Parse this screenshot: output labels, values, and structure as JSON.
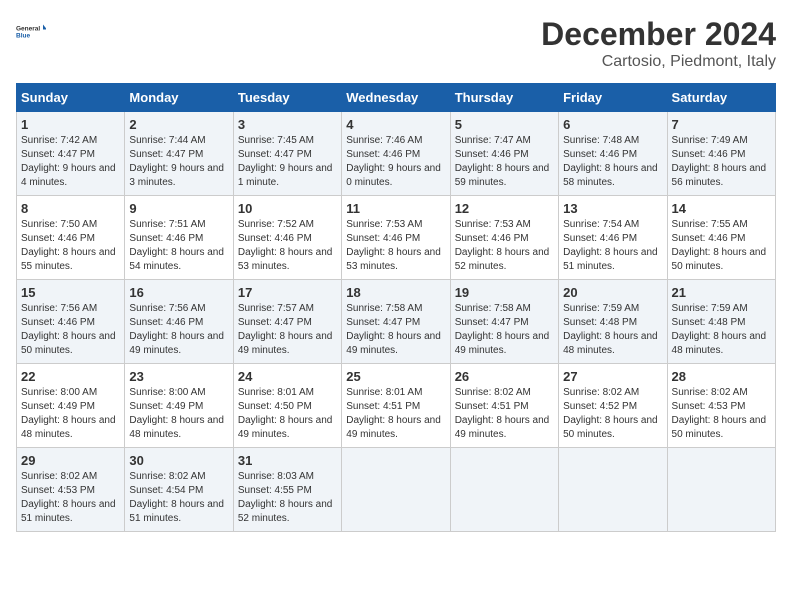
{
  "header": {
    "logo_general": "General",
    "logo_blue": "Blue",
    "month_year": "December 2024",
    "location": "Cartosio, Piedmont, Italy"
  },
  "weekdays": [
    "Sunday",
    "Monday",
    "Tuesday",
    "Wednesday",
    "Thursday",
    "Friday",
    "Saturday"
  ],
  "weeks": [
    [
      {
        "day": "1",
        "sunrise": "7:42 AM",
        "sunset": "4:47 PM",
        "daylight": "9 hours and 4 minutes."
      },
      {
        "day": "2",
        "sunrise": "7:44 AM",
        "sunset": "4:47 PM",
        "daylight": "9 hours and 3 minutes."
      },
      {
        "day": "3",
        "sunrise": "7:45 AM",
        "sunset": "4:47 PM",
        "daylight": "9 hours and 1 minute."
      },
      {
        "day": "4",
        "sunrise": "7:46 AM",
        "sunset": "4:46 PM",
        "daylight": "9 hours and 0 minutes."
      },
      {
        "day": "5",
        "sunrise": "7:47 AM",
        "sunset": "4:46 PM",
        "daylight": "8 hours and 59 minutes."
      },
      {
        "day": "6",
        "sunrise": "7:48 AM",
        "sunset": "4:46 PM",
        "daylight": "8 hours and 58 minutes."
      },
      {
        "day": "7",
        "sunrise": "7:49 AM",
        "sunset": "4:46 PM",
        "daylight": "8 hours and 56 minutes."
      }
    ],
    [
      {
        "day": "8",
        "sunrise": "7:50 AM",
        "sunset": "4:46 PM",
        "daylight": "8 hours and 55 minutes."
      },
      {
        "day": "9",
        "sunrise": "7:51 AM",
        "sunset": "4:46 PM",
        "daylight": "8 hours and 54 minutes."
      },
      {
        "day": "10",
        "sunrise": "7:52 AM",
        "sunset": "4:46 PM",
        "daylight": "8 hours and 53 minutes."
      },
      {
        "day": "11",
        "sunrise": "7:53 AM",
        "sunset": "4:46 PM",
        "daylight": "8 hours and 53 minutes."
      },
      {
        "day": "12",
        "sunrise": "7:53 AM",
        "sunset": "4:46 PM",
        "daylight": "8 hours and 52 minutes."
      },
      {
        "day": "13",
        "sunrise": "7:54 AM",
        "sunset": "4:46 PM",
        "daylight": "8 hours and 51 minutes."
      },
      {
        "day": "14",
        "sunrise": "7:55 AM",
        "sunset": "4:46 PM",
        "daylight": "8 hours and 50 minutes."
      }
    ],
    [
      {
        "day": "15",
        "sunrise": "7:56 AM",
        "sunset": "4:46 PM",
        "daylight": "8 hours and 50 minutes."
      },
      {
        "day": "16",
        "sunrise": "7:56 AM",
        "sunset": "4:46 PM",
        "daylight": "8 hours and 49 minutes."
      },
      {
        "day": "17",
        "sunrise": "7:57 AM",
        "sunset": "4:47 PM",
        "daylight": "8 hours and 49 minutes."
      },
      {
        "day": "18",
        "sunrise": "7:58 AM",
        "sunset": "4:47 PM",
        "daylight": "8 hours and 49 minutes."
      },
      {
        "day": "19",
        "sunrise": "7:58 AM",
        "sunset": "4:47 PM",
        "daylight": "8 hours and 49 minutes."
      },
      {
        "day": "20",
        "sunrise": "7:59 AM",
        "sunset": "4:48 PM",
        "daylight": "8 hours and 48 minutes."
      },
      {
        "day": "21",
        "sunrise": "7:59 AM",
        "sunset": "4:48 PM",
        "daylight": "8 hours and 48 minutes."
      }
    ],
    [
      {
        "day": "22",
        "sunrise": "8:00 AM",
        "sunset": "4:49 PM",
        "daylight": "8 hours and 48 minutes."
      },
      {
        "day": "23",
        "sunrise": "8:00 AM",
        "sunset": "4:49 PM",
        "daylight": "8 hours and 48 minutes."
      },
      {
        "day": "24",
        "sunrise": "8:01 AM",
        "sunset": "4:50 PM",
        "daylight": "8 hours and 49 minutes."
      },
      {
        "day": "25",
        "sunrise": "8:01 AM",
        "sunset": "4:51 PM",
        "daylight": "8 hours and 49 minutes."
      },
      {
        "day": "26",
        "sunrise": "8:02 AM",
        "sunset": "4:51 PM",
        "daylight": "8 hours and 49 minutes."
      },
      {
        "day": "27",
        "sunrise": "8:02 AM",
        "sunset": "4:52 PM",
        "daylight": "8 hours and 50 minutes."
      },
      {
        "day": "28",
        "sunrise": "8:02 AM",
        "sunset": "4:53 PM",
        "daylight": "8 hours and 50 minutes."
      }
    ],
    [
      {
        "day": "29",
        "sunrise": "8:02 AM",
        "sunset": "4:53 PM",
        "daylight": "8 hours and 51 minutes."
      },
      {
        "day": "30",
        "sunrise": "8:02 AM",
        "sunset": "4:54 PM",
        "daylight": "8 hours and 51 minutes."
      },
      {
        "day": "31",
        "sunrise": "8:03 AM",
        "sunset": "4:55 PM",
        "daylight": "8 hours and 52 minutes."
      },
      {
        "day": "",
        "sunrise": "",
        "sunset": "",
        "daylight": ""
      },
      {
        "day": "",
        "sunrise": "",
        "sunset": "",
        "daylight": ""
      },
      {
        "day": "",
        "sunrise": "",
        "sunset": "",
        "daylight": ""
      },
      {
        "day": "",
        "sunrise": "",
        "sunset": "",
        "daylight": ""
      }
    ]
  ]
}
